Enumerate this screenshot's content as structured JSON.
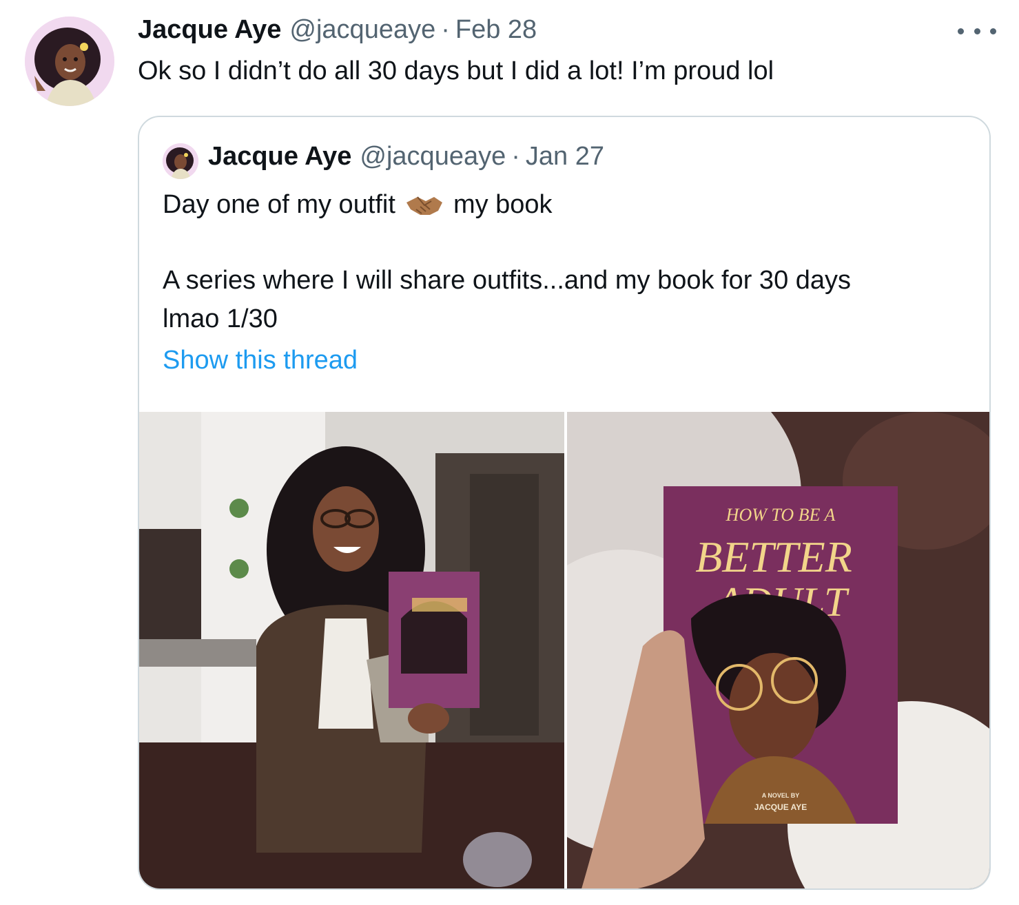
{
  "tweet": {
    "author_name": "Jacque Aye",
    "handle": "@jacqueaye",
    "separator": "·",
    "date": "Feb 28",
    "text": "Ok so I didn’t do all 30 days but I did a lot! I’m proud lol",
    "more_icon": "more-horizontal-icon"
  },
  "quoted": {
    "author_name": "Jacque Aye",
    "handle": "@jacqueaye",
    "separator": "·",
    "date": "Jan 27",
    "line1_before": "Day one of my outfit",
    "line1_emoji": "handshake-emoji",
    "line1_after": "my book",
    "line2": "A series where I will share outfits...and my book for 30 days",
    "line3": "lmao 1/30",
    "show_thread": "Show this thread",
    "link_color": "#1d9bf0",
    "book": {
      "title_top": "HOW TO BE A",
      "title_main1": "BETTER",
      "title_main2": "ADULT",
      "byline1": "A NOVEL BY",
      "byline2": "JACQUE AYE"
    }
  },
  "colors": {
    "text_primary": "#0f1419",
    "text_secondary": "#536471",
    "border": "#cfd9de",
    "book_purple": "#7a2f5e"
  }
}
